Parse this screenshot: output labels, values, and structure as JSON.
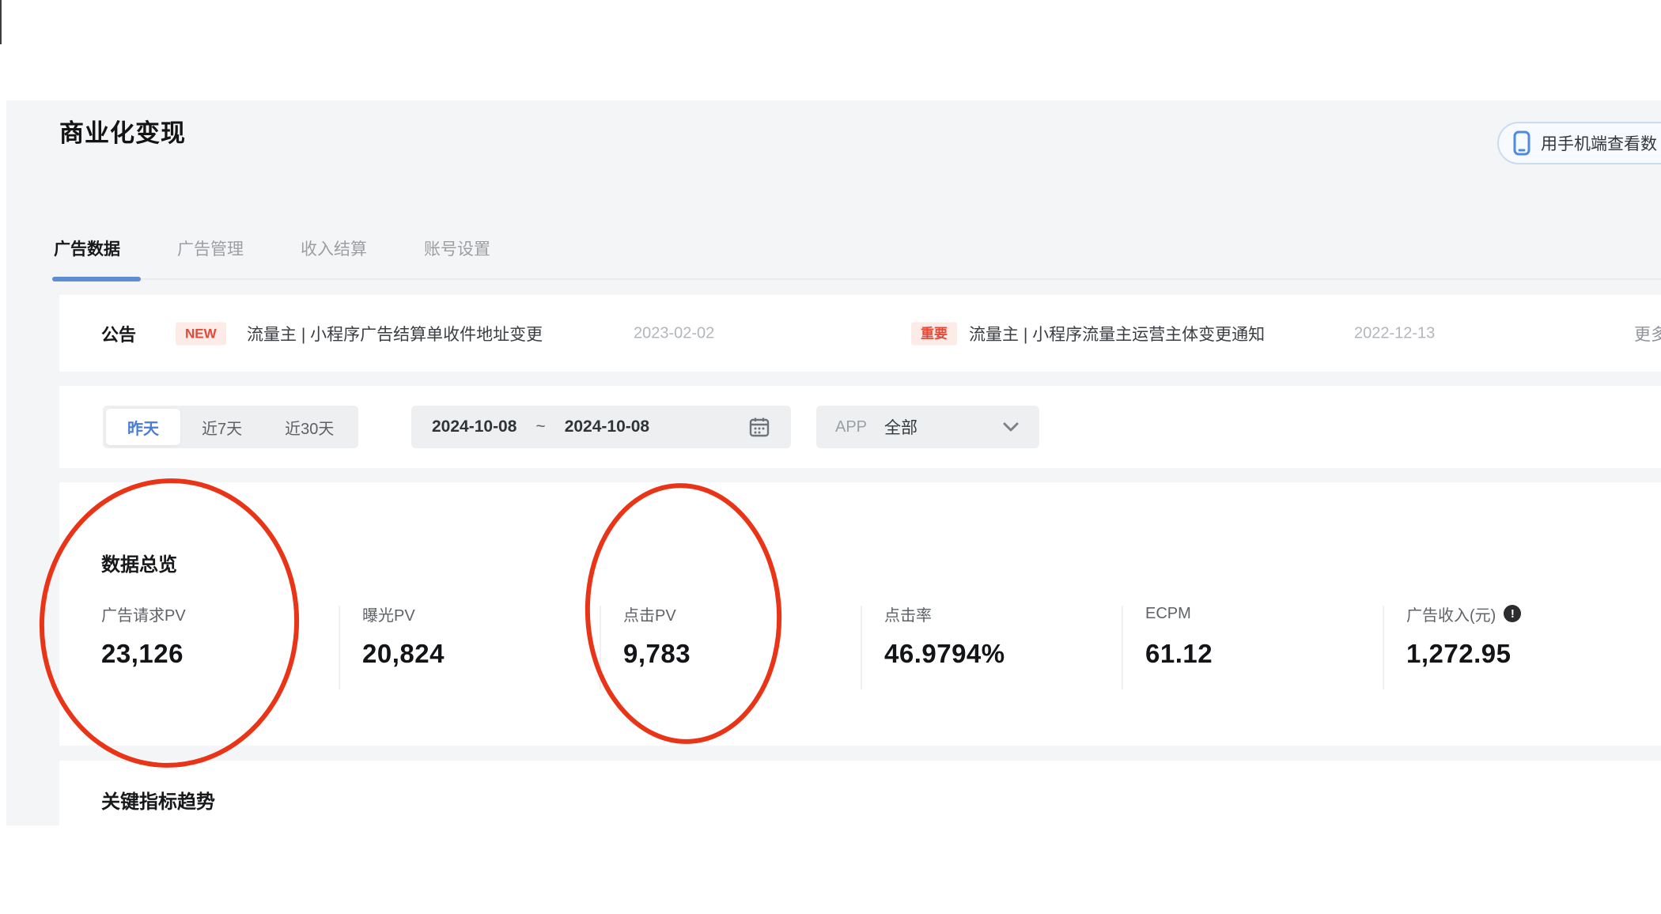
{
  "page": {
    "title": "商业化变现"
  },
  "header_button": {
    "label": "用手机端查看数",
    "icon": "phone-icon"
  },
  "tabs": [
    {
      "label": "广告数据",
      "active": true
    },
    {
      "label": "广告管理",
      "active": false
    },
    {
      "label": "收入结算",
      "active": false
    },
    {
      "label": "账号设置",
      "active": false
    }
  ],
  "announcement": {
    "title": "公告",
    "items": [
      {
        "badge": "NEW",
        "text": "流量主 | 小程序广告结算单收件地址变更",
        "date": "2023-02-02"
      },
      {
        "badge": "重要",
        "text": "流量主 | 小程序流量主运营主体变更通知",
        "date": "2022-12-13"
      }
    ],
    "more_label": "更多"
  },
  "filters": {
    "quick_ranges": [
      {
        "label": "昨天",
        "selected": true
      },
      {
        "label": "近7天",
        "selected": false
      },
      {
        "label": "近30天",
        "selected": false
      }
    ],
    "date_start": "2024-10-08",
    "date_separator": "~",
    "date_end": "2024-10-08",
    "calendar_icon": "calendar-icon",
    "app_label": "APP",
    "app_value": "全部",
    "chevron_icon": "chevron-down-icon"
  },
  "overview": {
    "title": "数据总览",
    "info_glyph": "!",
    "metrics": [
      {
        "label": "广告请求PV",
        "value": "23,126",
        "circled": true
      },
      {
        "label": "曝光PV",
        "value": "20,824",
        "circled": false
      },
      {
        "label": "点击PV",
        "value": "9,783",
        "circled": true
      },
      {
        "label": "点击率",
        "value": "46.9794%",
        "circled": false
      },
      {
        "label": "ECPM",
        "value": "61.12",
        "circled": false
      },
      {
        "label": "广告收入(元)",
        "value": "1,272.95",
        "circled": false,
        "info_icon": "info-icon"
      }
    ]
  },
  "trend": {
    "title": "关键指标趋势"
  },
  "annotations": {
    "shape": "red-ellipse",
    "color": "#ea3418",
    "targets": [
      "广告请求PV",
      "点击PV"
    ]
  }
}
